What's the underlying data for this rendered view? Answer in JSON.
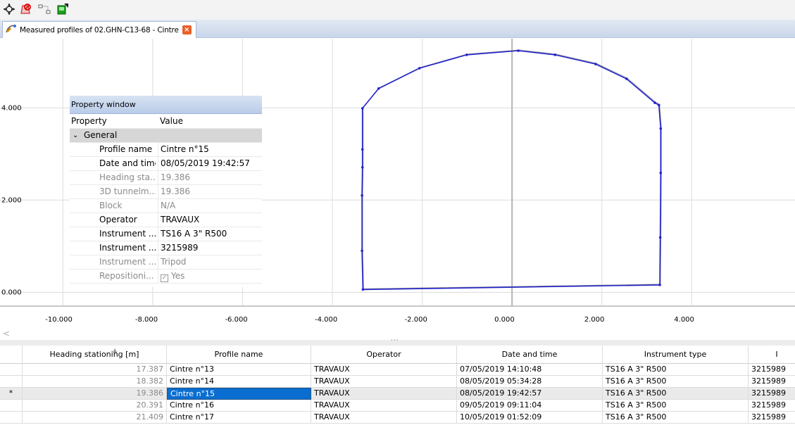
{
  "toolbar": {
    "buttons": [
      {
        "icon": "pan-crosshair-icon"
      },
      {
        "icon": "delete-profile-icon"
      },
      {
        "icon": "node-link-icon"
      },
      {
        "icon": "export-icon"
      }
    ]
  },
  "tab": {
    "label": "Measured profiles of 02.GHN-C13-68 - Cintre",
    "icon": "profile-icon",
    "close_glyph": "×"
  },
  "chart_data": {
    "type": "line",
    "title": "",
    "xlabel": "",
    "ylabel": "",
    "xlim": [
      -11.4,
      6.3
    ],
    "ylim": [
      -0.3,
      5.5
    ],
    "grid": true,
    "x_ticks": [
      "-10.000",
      "-8.000",
      "-6.000",
      "-4.000",
      "-2.000",
      "0.000",
      "2.000",
      "4.000"
    ],
    "x_tick_values": [
      -10,
      -8,
      -6,
      -4,
      -2,
      0,
      2,
      4
    ],
    "y_ticks": [
      "0.000",
      "2.000",
      "4.000"
    ],
    "y_tick_values": [
      0,
      2,
      4
    ],
    "series": [
      {
        "color": "#2222cc",
        "points": [
          [
            -3.32,
            0.06
          ],
          [
            -3.34,
            0.9
          ],
          [
            -3.34,
            2.1
          ],
          [
            -3.33,
            2.71
          ],
          [
            -3.33,
            3.1
          ],
          [
            -3.33,
            3.99
          ],
          [
            -2.97,
            4.42
          ],
          [
            -2.06,
            4.86
          ],
          [
            -1.01,
            5.15
          ],
          [
            0.14,
            5.24
          ],
          [
            0.96,
            5.15
          ],
          [
            1.86,
            4.95
          ],
          [
            2.55,
            4.63
          ],
          [
            3.18,
            4.11
          ],
          [
            3.27,
            4.06
          ],
          [
            3.31,
            3.55
          ],
          [
            3.31,
            2.59
          ],
          [
            3.3,
            1.19
          ],
          [
            3.29,
            0.16
          ]
        ]
      }
    ],
    "vertical_marker_x": 0
  },
  "property_window": {
    "title": "Property window",
    "col_property": "Property",
    "col_value": "Value",
    "group": "General",
    "rows": [
      {
        "name": "Profile name",
        "value": "Cintre n°15",
        "readonly": false
      },
      {
        "name": "Date and time",
        "value": "08/05/2019 19:42:57",
        "readonly": false
      },
      {
        "name": "Heading sta...",
        "value": "19.386",
        "readonly": true
      },
      {
        "name": "3D tunnelm...",
        "value": "19.386",
        "readonly": true
      },
      {
        "name": "Block",
        "value": "N/A",
        "readonly": true
      },
      {
        "name": "Operator",
        "value": "TRAVAUX",
        "readonly": false
      },
      {
        "name": "Instrument ...",
        "value": "TS16 A 3\" R500",
        "readonly": false
      },
      {
        "name": "Instrument ...",
        "value": "3215989",
        "readonly": false
      },
      {
        "name": "Instrument ...",
        "value": "Tripod",
        "readonly": true
      },
      {
        "name": "Repositioni...",
        "value": "Yes",
        "readonly": true
      }
    ]
  },
  "table": {
    "columns": [
      "Heading stationing [m]",
      "Profile name",
      "Operator",
      "Date and time",
      "Instrument type",
      "I"
    ],
    "rows": [
      {
        "marker": "",
        "heading": "17.387",
        "profile": "Cintre n°13",
        "operator": "TRAVAUX",
        "date": "07/05/2019 14:10:48",
        "instrument": "TS16 A 3\" R500",
        "serial": "3215989"
      },
      {
        "marker": "",
        "heading": "18.382",
        "profile": "Cintre n°14",
        "operator": "TRAVAUX",
        "date": "08/05/2019 05:34:28",
        "instrument": "TS16 A 3\" R500",
        "serial": "3215989"
      },
      {
        "marker": "*",
        "heading": "19.386",
        "profile": "Cintre n°15",
        "operator": "TRAVAUX",
        "date": "08/05/2019 19:42:57",
        "instrument": "TS16 A 3\" R500",
        "serial": "3215989"
      },
      {
        "marker": "",
        "heading": "20.391",
        "profile": "Cintre n°16",
        "operator": "TRAVAUX",
        "date": "09/05/2019 09:11:04",
        "instrument": "TS16 A 3\" R500",
        "serial": "3215989"
      },
      {
        "marker": "",
        "heading": "21.409",
        "profile": "Cintre n°17",
        "operator": "TRAVAUX",
        "date": "10/05/2019 01:52:09",
        "instrument": "TS16 A 3\" R500",
        "serial": "3215989"
      }
    ],
    "current_row": 2
  },
  "scroll": {
    "left_arrow": "<",
    "grip": "···"
  }
}
